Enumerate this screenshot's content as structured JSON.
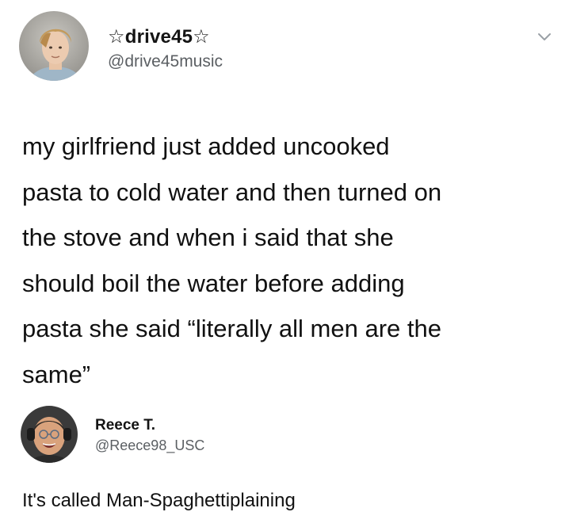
{
  "tweet": {
    "display_name": "☆drive45☆",
    "handle": "@drive45music",
    "text": "my girlfriend just added uncooked\npasta to cold water and then turned on\nthe stove and when i said that she\nshould boil the water before adding\npasta she said “literally all men are the\nsame”",
    "menu_icon": "chevron-down-icon"
  },
  "reply": {
    "display_name": "Reece T.",
    "handle": "@Reece98_USC",
    "text": "It's called Man-Spaghettiplaining"
  },
  "colors": {
    "text": "#111111",
    "secondary_text": "#5b5f63",
    "chevron": "#9aa0a6",
    "background": "#ffffff"
  }
}
